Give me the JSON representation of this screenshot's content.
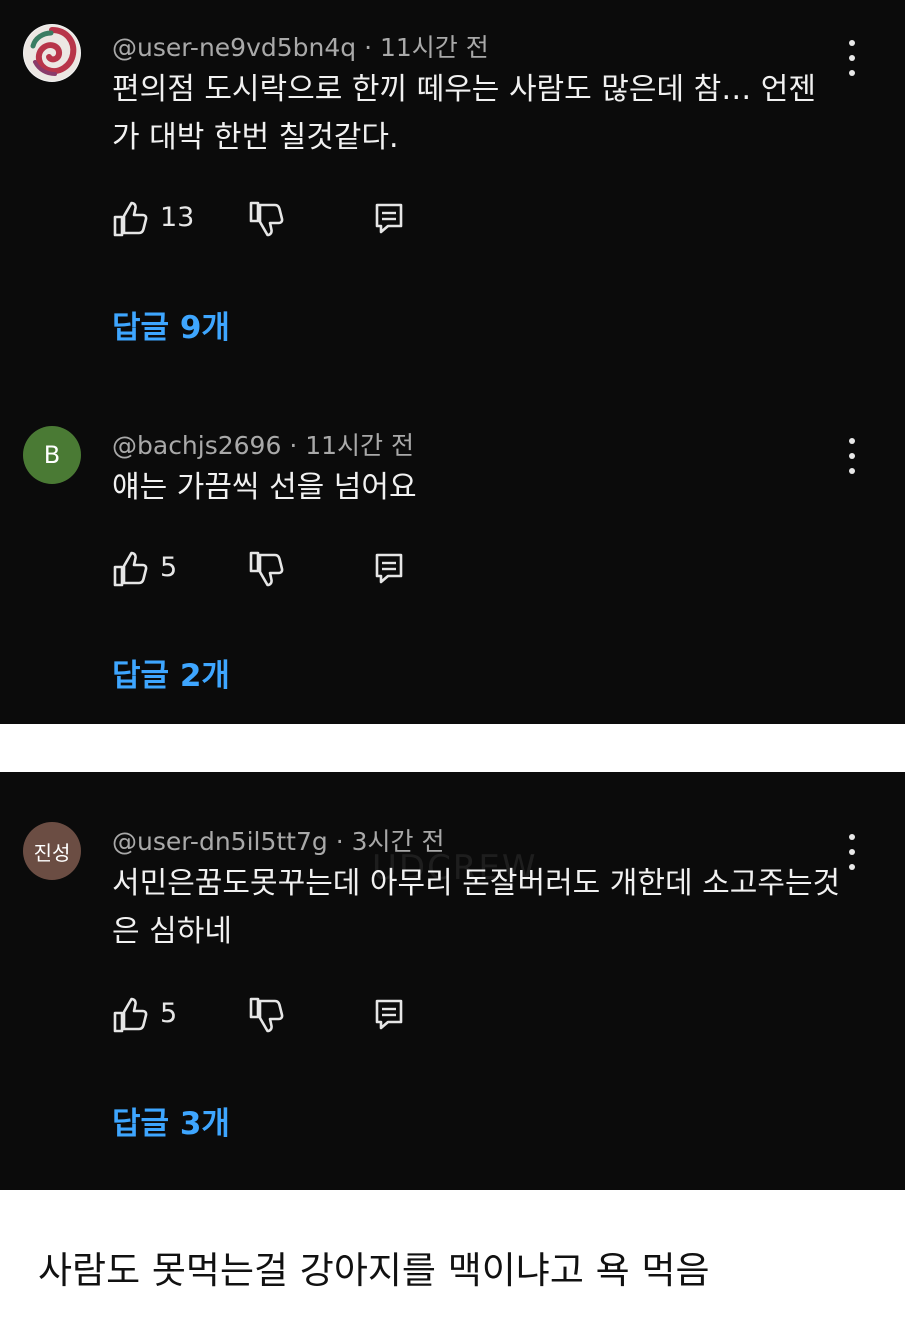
{
  "comments": [
    {
      "username": "@user-ne9vd5bn4q",
      "time": "11시간 전",
      "text": "편의점 도시락으로 한끼 떼우는 사람도 많은데 참… 언젠가 대박 한번 칠것같다.",
      "likes": "13",
      "replies": "답글 9개",
      "avatar": "swirl-logo"
    },
    {
      "username": "@bachjs2696",
      "time": "11시간 전",
      "text": "얘는 가끔씩 선을 넘어요",
      "likes": "5",
      "replies": "답글 2개",
      "avatar": "B"
    },
    {
      "username": "@user-dn5il5tt7g",
      "time": "3시간 전",
      "text": "서민은꿈도못꾸는데 아무리 돈잘버러도 개한데 소고주는것은 심하네",
      "likes": "5",
      "replies": "답글 3개",
      "avatar": "진성"
    }
  ],
  "separator": "·",
  "watermark": "UDCREW",
  "caption": "사람도 못먹는걸 강아지를 맥이냐고 욕 먹음",
  "colors": {
    "background": "#0b0b0b",
    "reply_link": "#3ea6ff",
    "meta_text": "#a9a9a9",
    "avatar_b": "#4a7a34",
    "avatar_jinseong": "#6b4d43"
  },
  "icons": [
    "thumbs-up-icon",
    "thumbs-down-icon",
    "reply-icon",
    "more-vert-icon"
  ]
}
